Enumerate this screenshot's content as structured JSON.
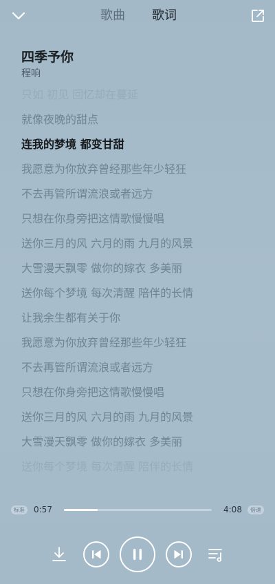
{
  "header": {
    "tabs": [
      {
        "label": "歌曲"
      },
      {
        "label": "歌词"
      }
    ],
    "active_tab": "歌词",
    "icons": [
      "chevron-down-icon",
      "share-icon"
    ]
  },
  "song": {
    "title": "四季予你",
    "artist": "程响"
  },
  "lyrics": {
    "lines": [
      "只如 初见 回忆却在蔓延",
      "就像夜晚的甜点",
      "连我的梦境 都变甘甜",
      "我愿意为你放弃曾经那些年少轻狂",
      "不去再管所谓流浪或者远方",
      "只想在你身旁把这情歌慢慢唱",
      "送你三月的风 六月的雨 九月的风景",
      "大雪漫天飘零 做你的嫁衣 多美丽",
      "送你每个梦境 每次清醒 陪伴的长情",
      "让我余生都有关于你",
      "我愿意为你放弃曾经那些年少轻狂",
      "不去再管所谓流浪或者远方",
      "只想在你身旁把这情歌慢慢唱",
      "送你三月的风 六月的雨 九月的风景",
      "大雪漫天飘零 做你的嫁衣 多美丽",
      "送你每个梦境 每次清醒 陪伴的长情"
    ],
    "active_index": 2
  },
  "player": {
    "quality_badge": "标准",
    "speed_badge": "倍速",
    "current_time": "0:57",
    "total_time": "4:08",
    "progress": 0.23,
    "icons": [
      "download-icon",
      "previous-icon",
      "pause-icon",
      "next-icon",
      "playlist-icon"
    ]
  },
  "colors": {
    "background": "#a6bccb",
    "active_lyric": "#15191c",
    "inactive_lyric": "#6f8494",
    "control_white": "#ffffff"
  }
}
